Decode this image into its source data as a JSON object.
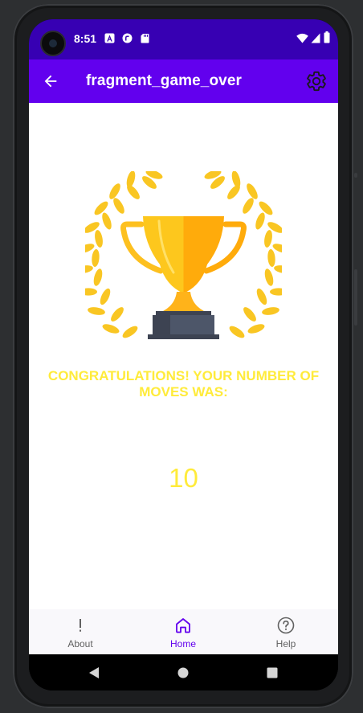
{
  "status_bar": {
    "time": "8:51"
  },
  "app_bar": {
    "title": "fragment_game_over"
  },
  "main": {
    "congrats_text": "CONGRATULATIONS! YOUR NUMBER OF MOVES WAS:",
    "moves_count": "10"
  },
  "bottom_nav": {
    "items": [
      {
        "label": "About",
        "icon": "exclamation-icon",
        "active": false
      },
      {
        "label": "Home",
        "icon": "home-icon",
        "active": true
      },
      {
        "label": "Help",
        "icon": "help-circle-icon",
        "active": false
      }
    ]
  },
  "colors": {
    "status_bar": "#3700b3",
    "app_bar": "#6200ee",
    "accent_text": "#ffeb3b",
    "nav_active": "#6200ee",
    "nav_inactive": "#616161"
  }
}
